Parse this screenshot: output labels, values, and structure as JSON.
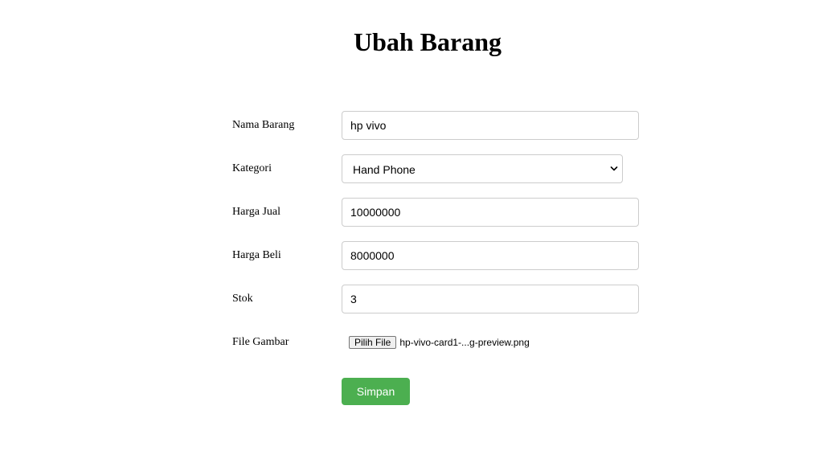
{
  "page": {
    "title": "Ubah Barang"
  },
  "form": {
    "nama_barang": {
      "label": "Nama Barang",
      "value": "hp vivo"
    },
    "kategori": {
      "label": "Kategori",
      "selected": "Hand Phone"
    },
    "harga_jual": {
      "label": "Harga Jual",
      "value": "10000000"
    },
    "harga_beli": {
      "label": "Harga Beli",
      "value": "8000000"
    },
    "stok": {
      "label": "Stok",
      "value": "3"
    },
    "file_gambar": {
      "label": "File Gambar",
      "button_label": "Pilih File",
      "file_name": "hp-vivo-card1-...g-preview.png"
    },
    "submit_label": "Simpan"
  },
  "colors": {
    "submit_background": "#4caf50",
    "input_border": "#cccccc"
  }
}
